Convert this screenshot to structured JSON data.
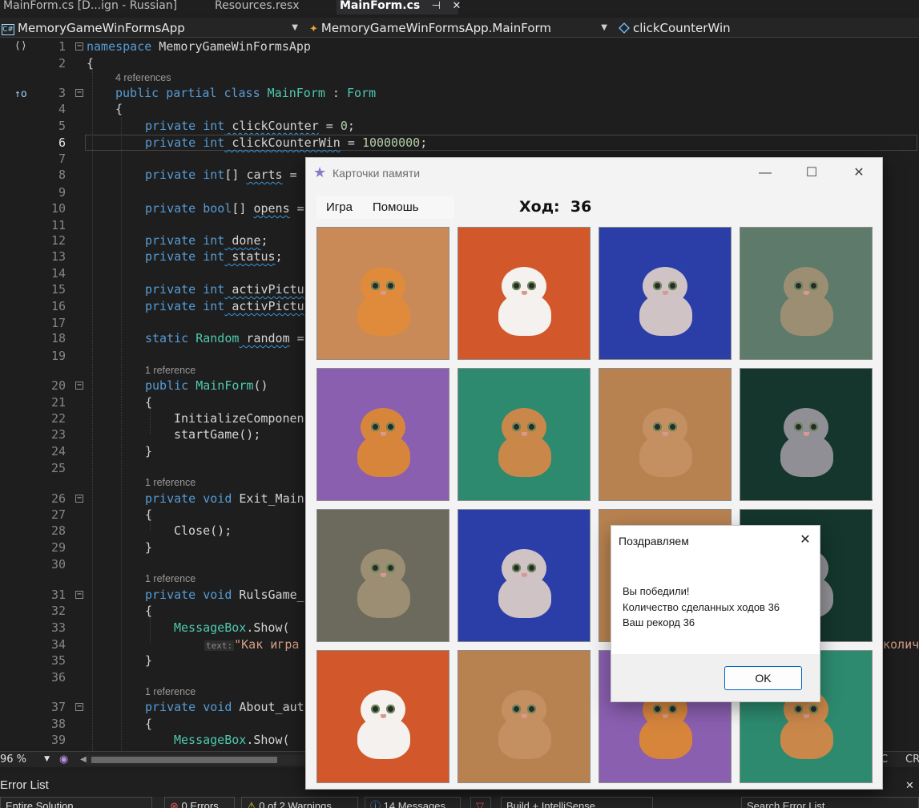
{
  "ide": {
    "doc_tabs": [
      {
        "label": "MainForm.cs [D...ign - Russian]",
        "active": false
      },
      {
        "label": "Resources.resx",
        "active": false
      },
      {
        "label": "MainForm.cs",
        "active": true
      }
    ],
    "tab_pin": "⊣",
    "tab_close": "✕",
    "nav": {
      "project": "MemoryGameWinFormsApp",
      "class": "MemoryGameWinFormsApp.MainForm",
      "member": "clickCounterWin",
      "project_badge": "C#"
    },
    "lenses": {
      "l3": "4 references",
      "l20": "1 reference",
      "l26": "1 reference",
      "l31": "1 reference",
      "l37": "1 reference"
    },
    "inlay_hint": "text:",
    "code": {
      "l1_kw": "namespace",
      "l1_name": " MemoryGameWinFormsApp",
      "l2": "{",
      "l3_a": "public partial class",
      "l3_b": " MainForm",
      "l3_c": " : ",
      "l3_d": "Form",
      "l4": "{",
      "l5_kw": "private int",
      "l5_id": " clickCounter",
      "l5_eq": " = ",
      "l5_num": "0",
      "l5_end": ";",
      "l6_kw": "private int",
      "l6_id": " clickCounterWin",
      "l6_eq": " = ",
      "l6_num": "10000000",
      "l6_end": ";",
      "l8_kw": "private int",
      "l8_rest": "[] ",
      "l8_id": "carts",
      "l8_end": " =",
      "l10_kw": "private bool",
      "l10_rest": "[] ",
      "l10_id": "opens",
      "l10_end": " =",
      "l12_kw": "private int",
      "l12_id": " done",
      "l12_end": ";",
      "l13_kw": "private int",
      "l13_id": " status",
      "l13_end": ";",
      "l15_kw": "private int",
      "l15_id": " activPictu",
      "l16_kw": "private int",
      "l16_id": " activPictu",
      "l18_kw": "static",
      "l18_ty": " Random",
      "l18_id": " random",
      "l18_end": " =",
      "l20_kw": "public",
      "l20_ty": " MainForm",
      "l20_end": "()",
      "l21": "{",
      "l22": "InitializeComponen",
      "l23": "startGame();",
      "l24": "}",
      "l26_kw": "private void",
      "l26_id": " Exit_Main",
      "l27": "{",
      "l28": "Close();",
      "l29": "}",
      "l31_kw": "private void",
      "l31_id": " RulsGame_",
      "l32": "{",
      "l33_ty": "MessageBox",
      "l33_mt": ".Show(",
      "l34_str": "\"Как игра",
      "l34_tail": "колич",
      "l35": "}",
      "l37_kw": "private void",
      "l37_id": " About_aut",
      "l38": "{",
      "l39_ty": "MessageBox",
      "l39_mt": ".Show("
    },
    "line_numbers": [
      "1",
      "2",
      "3",
      "4",
      "5",
      "6",
      "7",
      "8",
      "9",
      "10",
      "11",
      "12",
      "13",
      "14",
      "15",
      "16",
      "17",
      "18",
      "19",
      "20",
      "21",
      "22",
      "23",
      "24",
      "25",
      "26",
      "27",
      "28",
      "29",
      "30",
      "31",
      "32",
      "33",
      "34",
      "35",
      "36",
      "37",
      "38",
      "39"
    ],
    "status": {
      "zoom": "96 %",
      "right_a": "C",
      "right_b": "CR"
    },
    "panel": {
      "title": "Error List",
      "close": "✕",
      "scope": "Entire Solution",
      "errors": "0 Errors",
      "warnings": "0 of 2 Warnings",
      "messages": "14 Messages",
      "build": "Build + IntelliSense",
      "search": "Search Error List"
    }
  },
  "app": {
    "title": "Карточки памяти",
    "menu": [
      "Игра",
      "Помошь"
    ],
    "moves_label": "Ход:",
    "moves_value": "36",
    "window_buttons": {
      "minimize": "—",
      "maximize": "☐",
      "close": "✕"
    },
    "cards": [
      {
        "bg": "#c98a58",
        "fur": "#e08a3c"
      },
      {
        "bg": "#d2572a",
        "fur": "#f4f1ee"
      },
      {
        "bg": "#2b3ea8",
        "fur": "#cfc3c6"
      },
      {
        "bg": "#5d7a6a",
        "fur": "#9c8e73"
      },
      {
        "bg": "#8a5fb0",
        "fur": "#d8853c"
      },
      {
        "bg": "#2d8a6e",
        "fur": "#c9874a"
      },
      {
        "bg": "#b88250",
        "fur": "#c49062"
      },
      {
        "bg": "#14362c",
        "fur": "#8f8f95"
      },
      {
        "bg": "#6c6a5c",
        "fur": "#9c8e73"
      },
      {
        "bg": "#2b3ea8",
        "fur": "#cfc3c6"
      },
      {
        "bg": "#b88250",
        "fur": "#c49062"
      },
      {
        "bg": "#14362c",
        "fur": "#8f8f95"
      },
      {
        "bg": "#d2572a",
        "fur": "#f4f1ee"
      },
      {
        "bg": "#b88250",
        "fur": "#c49062"
      },
      {
        "bg": "#8a5fb0",
        "fur": "#d8853c"
      },
      {
        "bg": "#2d8a6e",
        "fur": "#c9874a"
      }
    ]
  },
  "dialog": {
    "title": "Поздравляем",
    "close": "✕",
    "lines": [
      "Вы победили!",
      "Количество сделанных ходов 36",
      "Ваш рекорд 36"
    ],
    "ok": "OK"
  }
}
